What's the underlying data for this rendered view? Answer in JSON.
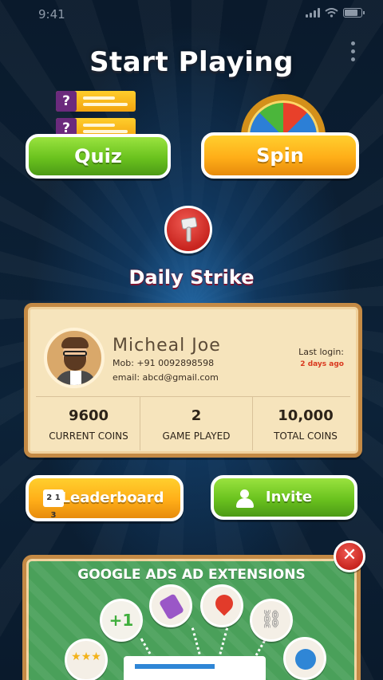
{
  "status_bar": {
    "time": "9:41"
  },
  "header": {
    "title": "Start Playing"
  },
  "game_modes": {
    "quiz_label": "Quiz",
    "spin_label": "Spin"
  },
  "daily_strike": {
    "label": "Daily Strike"
  },
  "profile": {
    "name": "Micheal Joe",
    "mobile": "Mob: +91 0092898598",
    "email": "email: abcd@gmail.com",
    "last_login_label": "Last login:",
    "last_login_value": "2 days ago",
    "stats": [
      {
        "value": "9600",
        "label": "CURRENT COINS"
      },
      {
        "value": "2",
        "label": "GAME PLAYED"
      },
      {
        "value": "10,000",
        "label": "TOTAL COINS"
      }
    ]
  },
  "actions": {
    "leaderboard_label": "Leaderboard",
    "leaderboard_icon_text": "2 1 3",
    "invite_label": "Invite"
  },
  "ad": {
    "title": "GOOGLE ADS AD EXTENSIONS",
    "plus_one": "+1",
    "stars": "★★★",
    "close_symbol": "✕",
    "link_symbol": "⛓"
  },
  "colors": {
    "green": "#6ac21e",
    "orange": "#ffae18",
    "red": "#c8251f",
    "card": "#f6e4bc",
    "last_login": "#d9381e"
  }
}
